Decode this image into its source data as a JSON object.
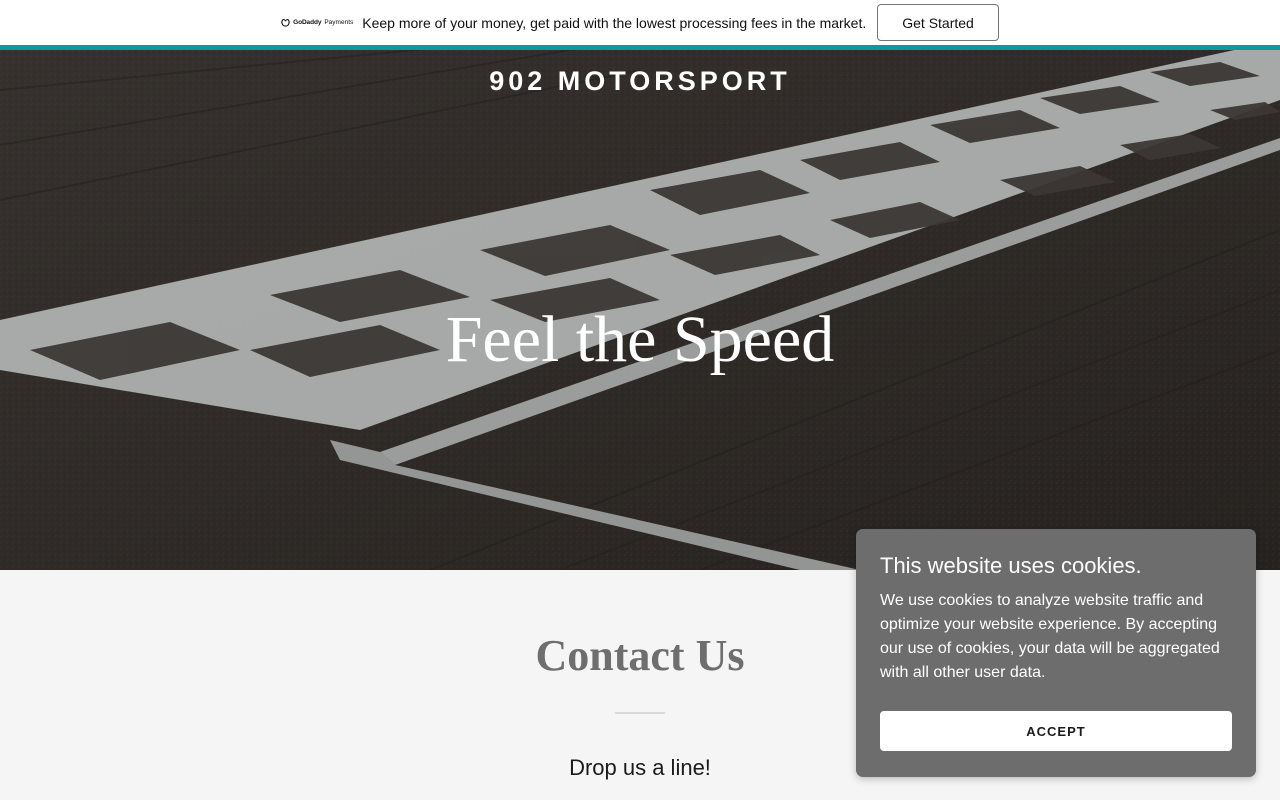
{
  "promo": {
    "logo_brand": "GoDaddy",
    "logo_sub": "Payments",
    "message": "Keep more of your money, get paid with the lowest processing fees in the market.",
    "cta_label": "Get Started",
    "stripe_color": "#0e9a9a"
  },
  "header": {
    "site_title": "902 MOTORSPORT"
  },
  "hero": {
    "heading": "Feel the Speed"
  },
  "contact": {
    "title": "Contact Us",
    "subtitle": "Drop us a line!"
  },
  "cookie_banner": {
    "title": "This website uses cookies.",
    "body": "We use cookies to analyze website traffic and optimize your website experience. By accepting our use of cookies, your data will be aggregated with all other user data.",
    "accept_label": "ACCEPT"
  }
}
